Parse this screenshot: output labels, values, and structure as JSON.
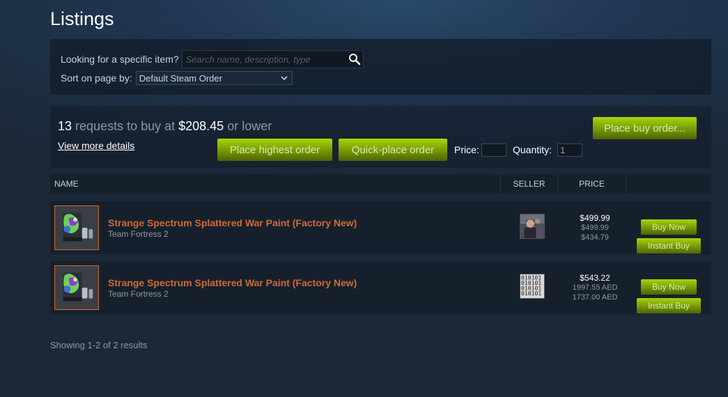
{
  "page": {
    "title": "Listings"
  },
  "search": {
    "label": "Looking for a specific item?",
    "placeholder": "Search name, description, type",
    "sort_label": "Sort on page by:",
    "sort_value": "Default Steam Order"
  },
  "buy_orders": {
    "count": "13",
    "text_mid": " requests to buy at ",
    "price": "$208.45",
    "text_end": " or lower",
    "view_more": "View more details",
    "place_buy_order": "Place buy order...",
    "place_highest": "Place highest order",
    "quick_place": "Quick-place order",
    "price_label": "Price:",
    "price_value": "",
    "quantity_label": "Quantity:",
    "quantity_value": "1"
  },
  "table": {
    "col_name": "NAME",
    "col_seller": "SELLER",
    "col_price": "PRICE",
    "rows": [
      {
        "name": "Strange Spectrum Splattered War Paint (Factory New)",
        "game": "Team Fortress 2",
        "seller_icon": "user-avatar",
        "price_main": "$499.99",
        "price_sub1": "$499.99",
        "price_sub2": "$434.79",
        "buy_now": "Buy Now",
        "instant_buy": "Instant Buy"
      },
      {
        "name": "Strange Spectrum Splattered War Paint (Factory New)",
        "game": "Team Fortress 2",
        "seller_icon": "binary-avatar",
        "price_main": "$543.22",
        "price_sub1": "1997.55 AED",
        "price_sub2": "1737.00 AED",
        "buy_now": "Buy Now",
        "instant_buy": "Instant Buy"
      }
    ]
  },
  "footer": {
    "results": "Showing 1-2 of 2 results"
  },
  "colors": {
    "background": "#1b2838",
    "item_name": "#cf6a32",
    "button_green": "#a4d007",
    "text_muted": "#8f98a0"
  }
}
